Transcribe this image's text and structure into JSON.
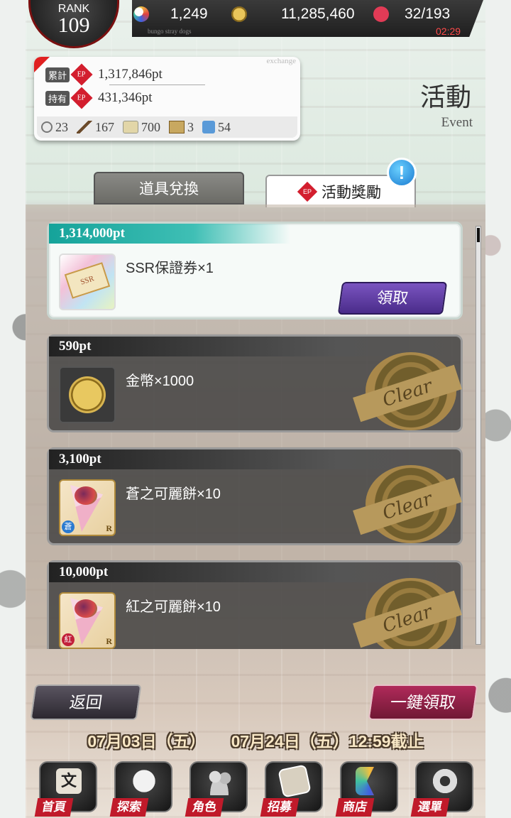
{
  "status": {
    "rank_label": "RANK",
    "rank": "109",
    "moons": "1,249",
    "coins": "11,285,460",
    "stamina": "32/193",
    "timer": "02:29",
    "subtitle": "bungo stray dogs"
  },
  "points": {
    "exchange_label": "exchange",
    "total_label": "累計",
    "total": "1,317,846pt",
    "held_label": "持有",
    "held": "431,346pt",
    "ep_label": "EP",
    "items": [
      {
        "icon": "magnifier-icon",
        "count": "23"
      },
      {
        "icon": "brush-icon",
        "count": "167"
      },
      {
        "icon": "scroll-icon",
        "count": "700"
      },
      {
        "icon": "book-icon",
        "count": "3"
      },
      {
        "icon": "cup-icon",
        "count": "54"
      }
    ]
  },
  "header": {
    "title": "活動",
    "subtitle": "Event"
  },
  "tabs": [
    {
      "label": "道具兌換",
      "active": false
    },
    {
      "label": "活動獎勵",
      "active": true
    }
  ],
  "notification_badge": "!",
  "rewards": [
    {
      "points": "1,314,000pt",
      "name": "SSR保證券×1",
      "state": "claimable",
      "icon": "ssr-ticket-icon",
      "icon_text": "SSR"
    },
    {
      "points": "590pt",
      "name": "金幣×1000",
      "state": "cleared",
      "icon": "gold-coin-icon"
    },
    {
      "points": "3,100pt",
      "name": "蒼之可麗餅×10",
      "state": "cleared",
      "icon": "blue-crepe-icon",
      "badge": "蒼",
      "rarity": "R"
    },
    {
      "points": "10,000pt",
      "name": "紅之可麗餅×10",
      "state": "cleared",
      "icon": "red-crepe-icon",
      "badge": "紅",
      "rarity": "R"
    }
  ],
  "claim_label": "領取",
  "stamp_text": "Clear",
  "buttons": {
    "back": "返回",
    "claim_all": "一鍵領取"
  },
  "period": {
    "start": "07月03日（五）",
    "end": "07月24日（五）12:59截止"
  },
  "nav": [
    {
      "label": "首頁",
      "icon": "home-icon",
      "icon_text": "文"
    },
    {
      "label": "探索",
      "icon": "tiger-icon"
    },
    {
      "label": "角色",
      "icon": "characters-icon"
    },
    {
      "label": "招募",
      "icon": "recruit-card-icon"
    },
    {
      "label": "商店",
      "icon": "moon-shop-icon"
    },
    {
      "label": "選單",
      "icon": "gear-menu-icon"
    }
  ],
  "colors": {
    "accent_teal": "#15a39a",
    "claim_purple": "#5a3aa0",
    "claim_all_red": "#8a1f40",
    "timer_red": "#ff4a4a"
  }
}
